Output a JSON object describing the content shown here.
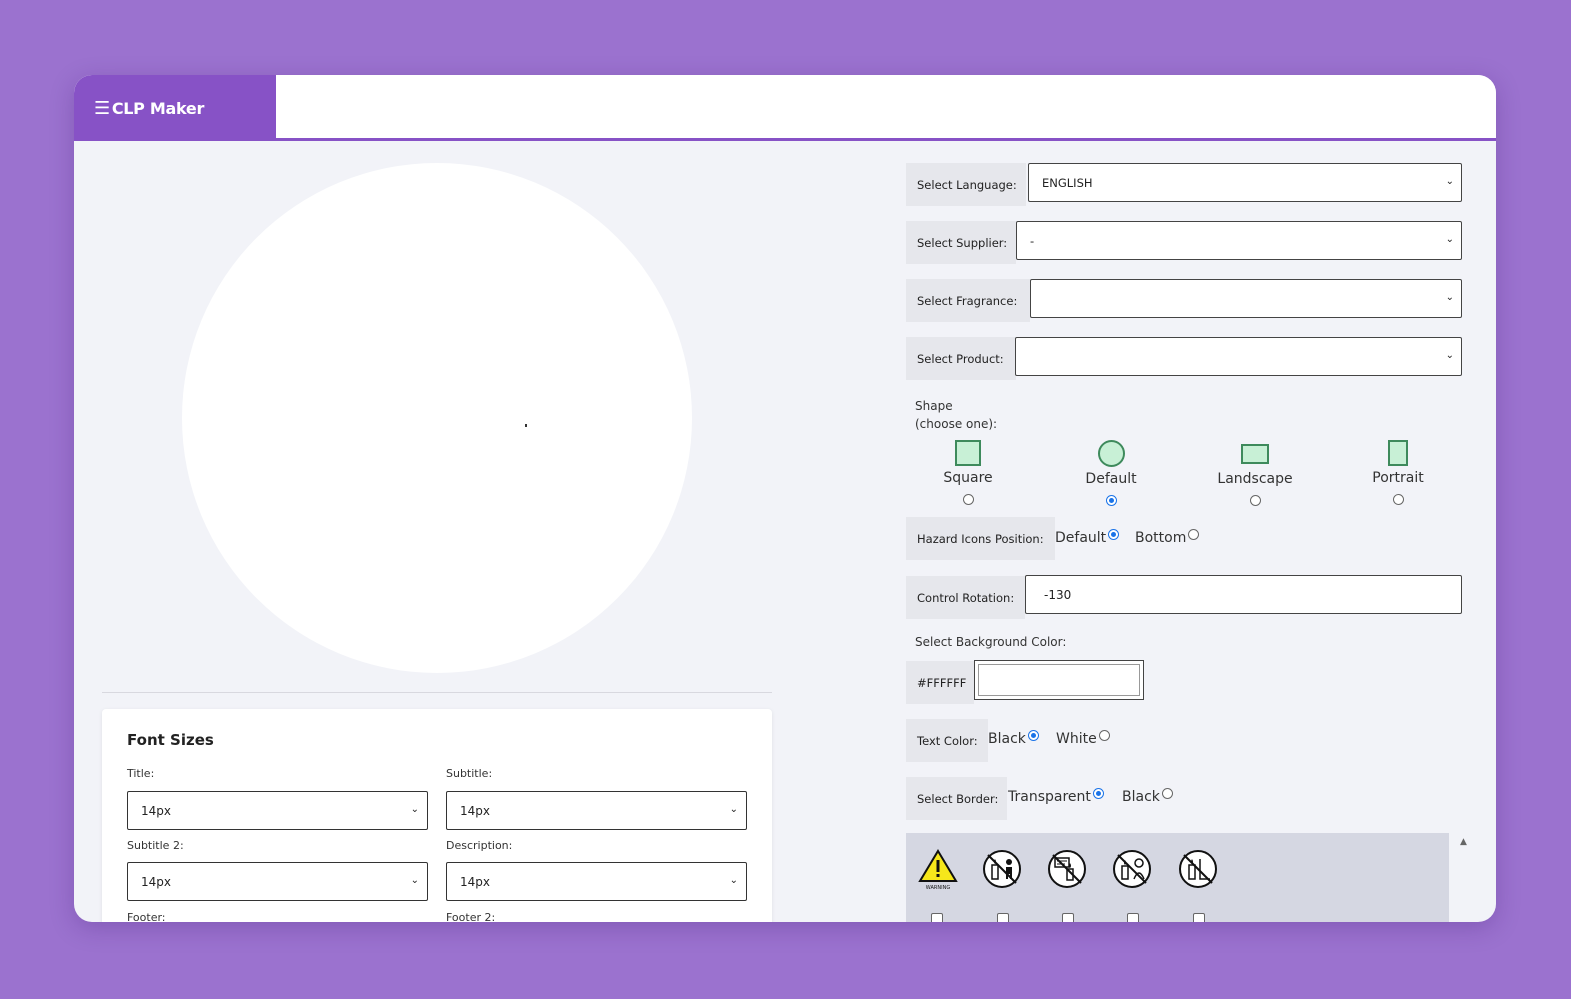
{
  "app": {
    "title": "CLP Maker",
    "menu_icon": "hamburger-icon"
  },
  "font_sizes": {
    "heading": "Font Sizes",
    "fields": [
      {
        "label": "Title:",
        "value": "14px"
      },
      {
        "label": "Subtitle:",
        "value": "14px"
      },
      {
        "label": "Subtitle 2:",
        "value": "14px"
      },
      {
        "label": "Description:",
        "value": "14px"
      },
      {
        "label": "Footer:"
      },
      {
        "label": "Footer 2:"
      }
    ]
  },
  "form": {
    "language": {
      "label": "Select Language:",
      "value": "ENGLISH"
    },
    "supplier": {
      "label": "Select Supplier:",
      "value": "-"
    },
    "fragrance": {
      "label": "Select Fragrance:",
      "value": ""
    },
    "product": {
      "label": "Select Product:",
      "value": ""
    },
    "shape": {
      "label_line1": "Shape",
      "label_line2": "(choose one):",
      "options": [
        {
          "name": "Square",
          "selected": false
        },
        {
          "name": "Default",
          "selected": true
        },
        {
          "name": "Landscape",
          "selected": false
        },
        {
          "name": "Portrait",
          "selected": false
        }
      ]
    },
    "hazard_position": {
      "label": "Hazard Icons Position:",
      "options": [
        "Default",
        "Bottom"
      ],
      "selected": "Default"
    },
    "rotation": {
      "label": "Control Rotation:",
      "value": "-130"
    },
    "background": {
      "label": "Select Background Color:",
      "hex": "#FFFFFF"
    },
    "text_color": {
      "label": "Text Color:",
      "options": [
        "Black",
        "White"
      ],
      "selected": "Black"
    },
    "border": {
      "label": "Select Border:",
      "options": [
        "Transparent",
        "Black"
      ],
      "selected": "Transparent"
    },
    "hazard_icons": [
      {
        "icon": "warning-triangle-icon",
        "caption": "WARNING"
      },
      {
        "icon": "no-children-candle-icon"
      },
      {
        "icon": "no-flammable-near-candle-icon"
      },
      {
        "icon": "no-unattended-candle-icon"
      },
      {
        "icon": "no-draft-candle-icon"
      }
    ]
  },
  "colors": {
    "accent": "#8752c6",
    "background": "#9b72cf",
    "panel": "#f2f3f8",
    "shape_fill": "#c8f0d6",
    "shape_stroke": "#3e8a5c",
    "radio_on": "#1a73e8"
  }
}
